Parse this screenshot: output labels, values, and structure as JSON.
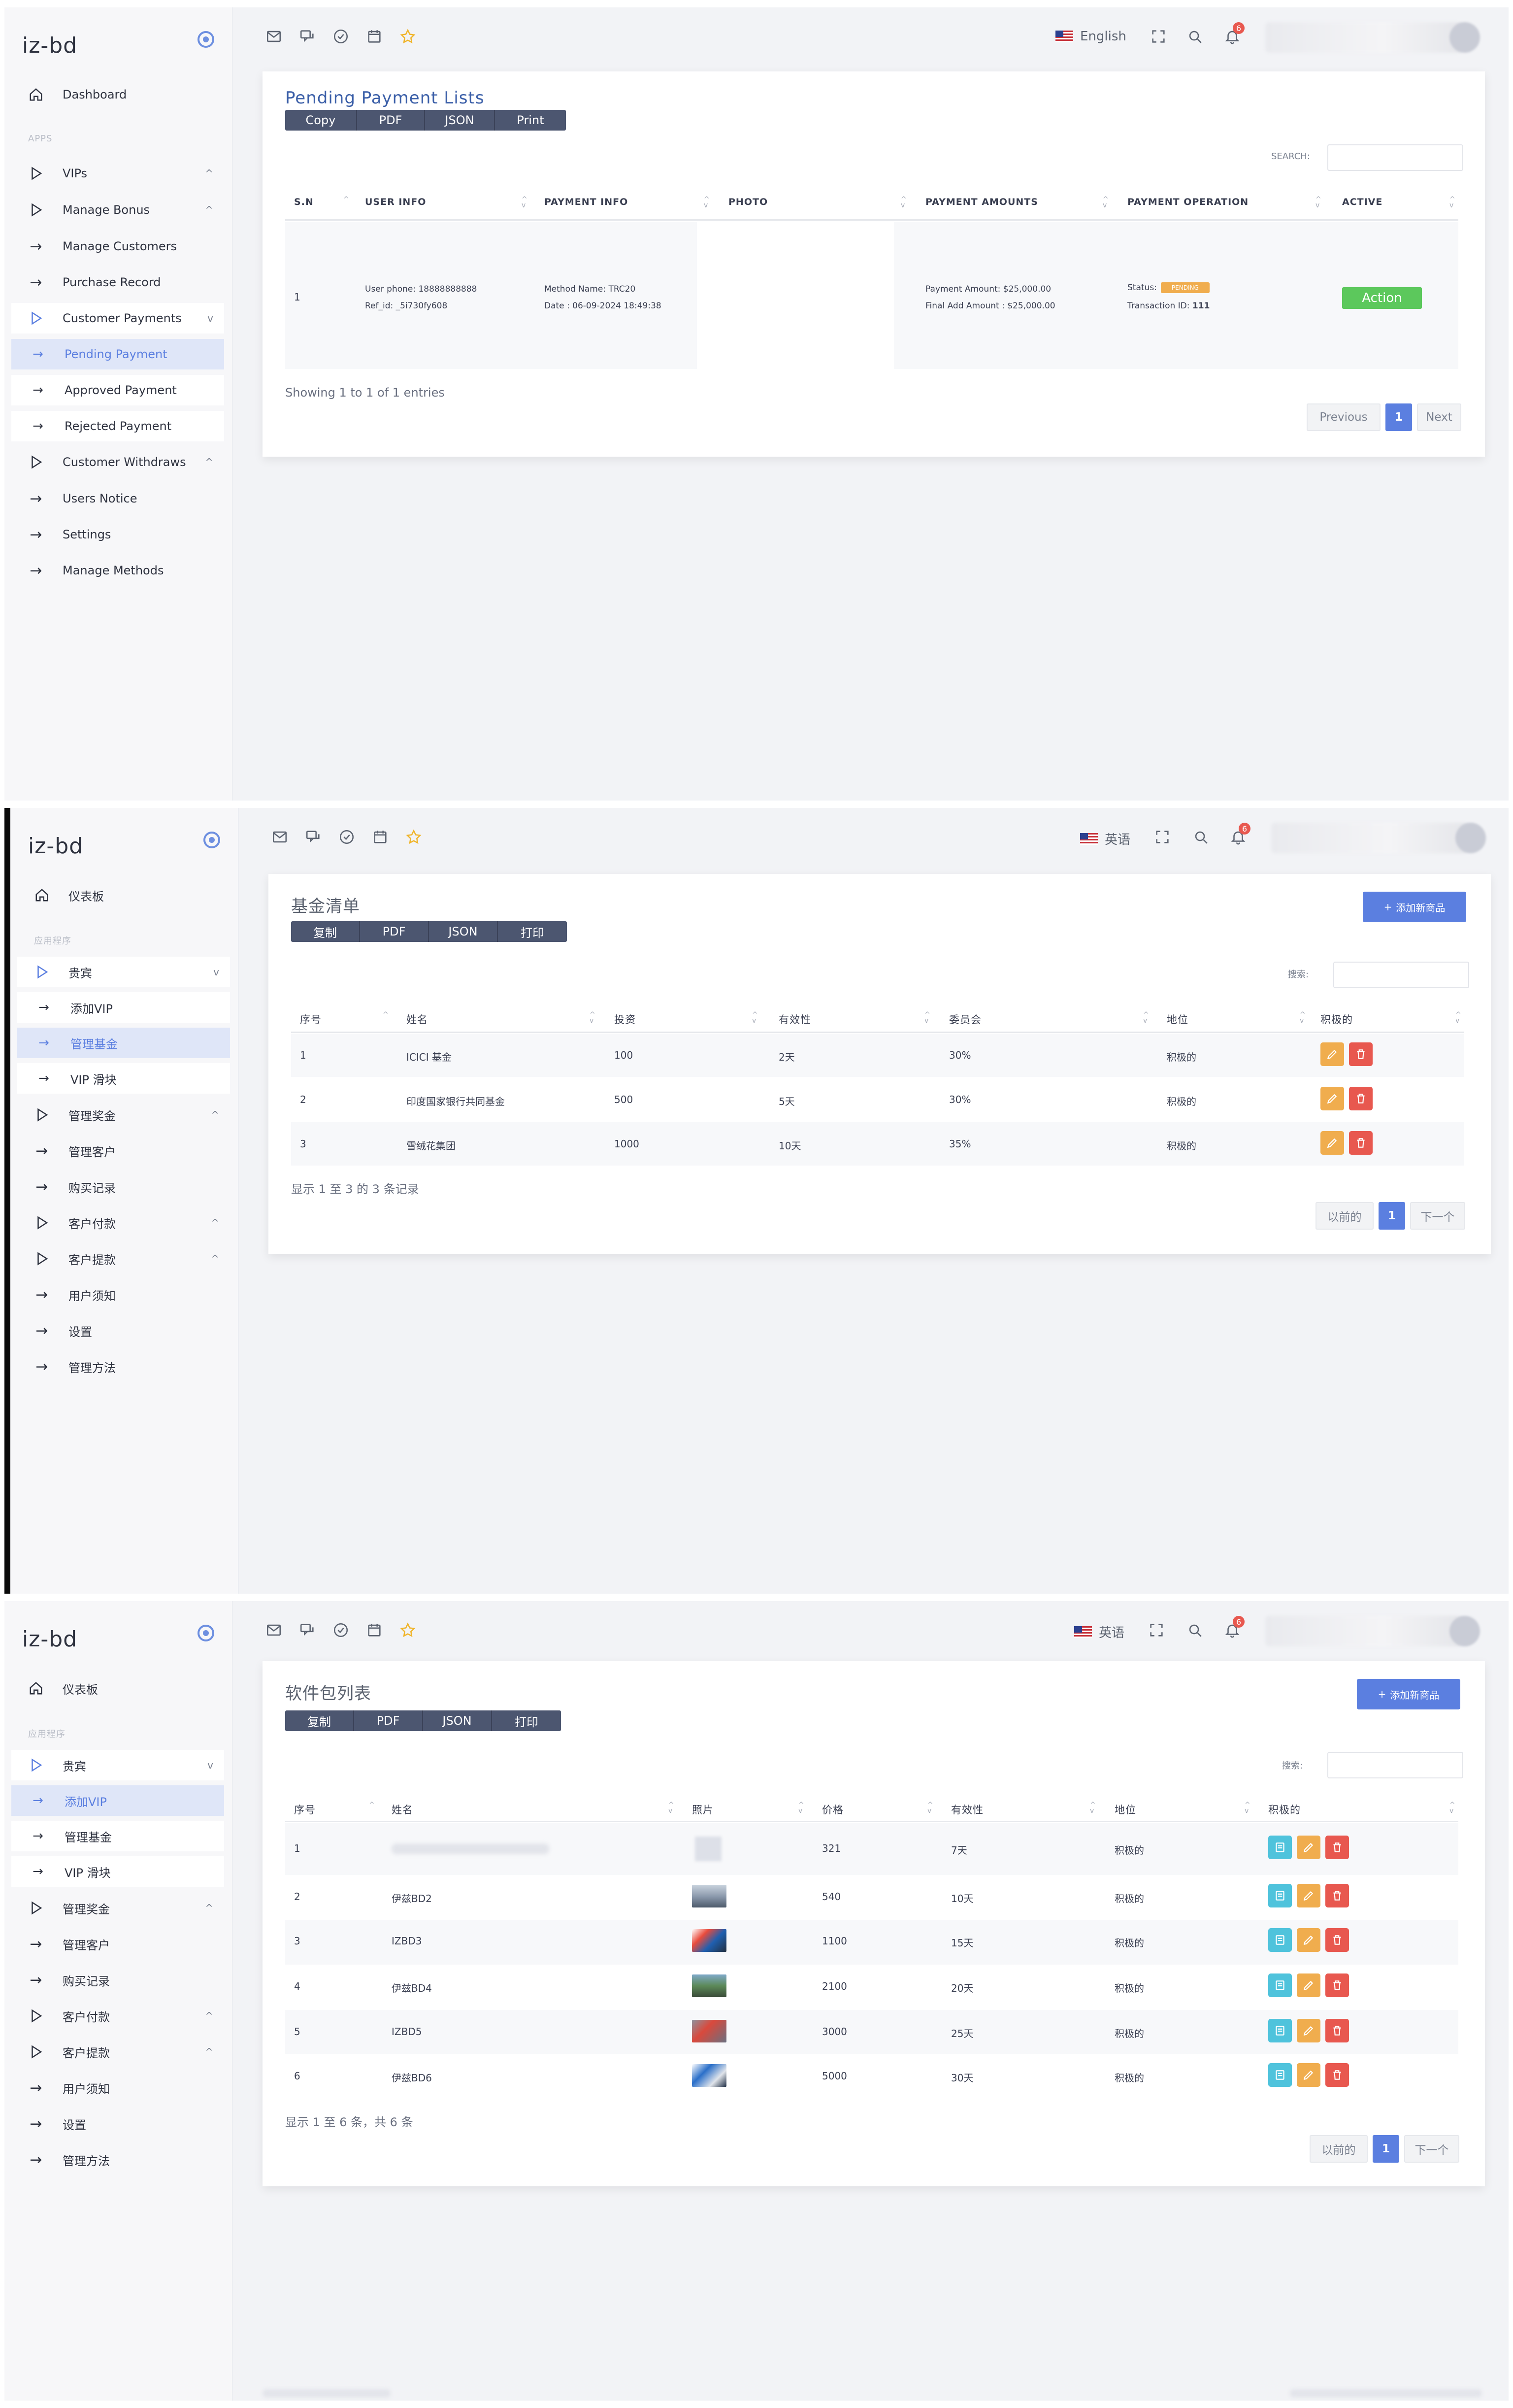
{
  "s1": {
    "logo": "iz-bd",
    "menu": {
      "dashboard": "Dashboard",
      "apps_heading": "APPS",
      "vips": "VIPs",
      "manage_bonus": "Manage Bonus",
      "manage_customers": "Manage Customers",
      "purchase_record": "Purchase Record",
      "customer_payments": "Customer Payments",
      "pending_payment": "Pending Payment",
      "approved_payment": "Approved Payment",
      "rejected_payment": "Rejected Payment",
      "customer_withdraws": "Customer Withdraws",
      "users_notice": "Users Notice",
      "settings": "Settings",
      "manage_methods": "Manage Methods"
    },
    "language": "English",
    "notification_count": "6",
    "title": "Pending Payment Lists",
    "buttons": [
      "Copy",
      "PDF",
      "JSON",
      "Print"
    ],
    "search_label": "SEARCH:",
    "columns": [
      "S.N",
      "USER INFO",
      "PAYMENT INFO",
      "PHOTO",
      "PAYMENT AMOUNTS",
      "PAYMENT OPERATION",
      "ACTIVE"
    ],
    "row": {
      "sn": "1",
      "user_phone": "User phone: 18888888888",
      "ref_id": "Ref_id: _5i730fy608",
      "method": "Method Name: TRC20",
      "date": "Date : 06-09-2024 18:49:38",
      "amount": "Payment Amount: $25,000.00",
      "final_amount": "Final Add Amount : $25,000.00",
      "status_label": "Status:",
      "status_value": "PENDING",
      "transaction_label": "Transaction ID:",
      "transaction_id": "111",
      "action": "Action"
    },
    "showing": "Showing 1 to 1 of 1 entries",
    "pager": {
      "prev": "Previous",
      "page": "1",
      "next": "Next"
    }
  },
  "s2": {
    "logo": "iz-bd",
    "menu": {
      "dashboard": "仪表板",
      "apps_heading": "应用程序",
      "vip": "贵宾",
      "add_vip": "添加VIP",
      "manage_fund": "管理基金",
      "vip_slider": "VIP 滑块",
      "manage_bonus": "管理奖金",
      "manage_customers": "管理客户",
      "purchase_record": "购买记录",
      "customer_payments": "客户付款",
      "customer_withdraws": "客户提款",
      "users_notice": "用户须知",
      "settings": "设置",
      "manage_methods": "管理方法"
    },
    "language": "英语",
    "notification_count": "6",
    "title": "基金清单",
    "add_button": "添加新商品",
    "buttons": [
      "复制",
      "PDF",
      "JSON",
      "打印"
    ],
    "search_label": "搜索:",
    "columns": [
      "序号",
      "姓名",
      "投资",
      "有效性",
      "委员会",
      "地位",
      "积极的"
    ],
    "rows": [
      {
        "sn": "1",
        "name": "ICICI 基金",
        "investment": "100",
        "validity": "2天",
        "commission": "30%",
        "status": "积极的"
      },
      {
        "sn": "2",
        "name": "印度国家银行共同基金",
        "investment": "500",
        "validity": "5天",
        "commission": "30%",
        "status": "积极的"
      },
      {
        "sn": "3",
        "name": "雪绒花集团",
        "investment": "1000",
        "validity": "10天",
        "commission": "35%",
        "status": "积极的"
      }
    ],
    "showing": "显示 1 至 3 的 3 条记录",
    "pager": {
      "prev": "以前的",
      "page": "1",
      "next": "下一个"
    }
  },
  "s3": {
    "logo": "iz-bd",
    "menu": {
      "dashboard": "仪表板",
      "apps_heading": "应用程序",
      "vip": "贵宾",
      "add_vip": "添加VIP",
      "manage_fund": "管理基金",
      "vip_slider": "VIP 滑块",
      "manage_bonus": "管理奖金",
      "manage_customers": "管理客户",
      "purchase_record": "购买记录",
      "customer_payments": "客户付款",
      "customer_withdraws": "客户提款",
      "users_notice": "用户须知",
      "settings": "设置",
      "manage_methods": "管理方法"
    },
    "language": "英语",
    "notification_count": "6",
    "title": "软件包列表",
    "add_button": "添加新商品",
    "buttons": [
      "复制",
      "PDF",
      "JSON",
      "打印"
    ],
    "search_label": "搜索:",
    "columns": [
      "序号",
      "姓名",
      "照片",
      "价格",
      "有效性",
      "地位",
      "积极的"
    ],
    "rows": [
      {
        "sn": "1",
        "name": "",
        "price": "321",
        "validity": "7天",
        "status": "积极的"
      },
      {
        "sn": "2",
        "name": "伊兹BD2",
        "price": "540",
        "validity": "10天",
        "status": "积极的"
      },
      {
        "sn": "3",
        "name": "IZBD3",
        "price": "1100",
        "validity": "15天",
        "status": "积极的"
      },
      {
        "sn": "4",
        "name": "伊兹BD4",
        "price": "2100",
        "validity": "20天",
        "status": "积极的"
      },
      {
        "sn": "5",
        "name": "IZBD5",
        "price": "3000",
        "validity": "25天",
        "status": "积极的"
      },
      {
        "sn": "6",
        "name": "伊兹BD6",
        "price": "5000",
        "validity": "30天",
        "status": "积极的"
      }
    ],
    "showing": "显示 1 至 6 条，共 6 条",
    "pager": {
      "prev": "以前的",
      "page": "1",
      "next": "下一个"
    }
  },
  "colors": {
    "accent": "#5b7fe0",
    "button_group": "#4c5670",
    "action_green": "#5cc85c",
    "pending_orange": "#f0ad4e",
    "delete_red": "#e8584f",
    "view_cyan": "#4fc3dc"
  },
  "icons": [
    "mail-icon",
    "chat-icon",
    "check-circle-icon",
    "calendar-icon",
    "star-icon",
    "fullscreen-icon",
    "search-icon",
    "bell-icon",
    "home-icon",
    "play-outline-icon",
    "arrow-right-icon",
    "pencil-icon",
    "trash-icon",
    "document-icon",
    "target-icon"
  ]
}
